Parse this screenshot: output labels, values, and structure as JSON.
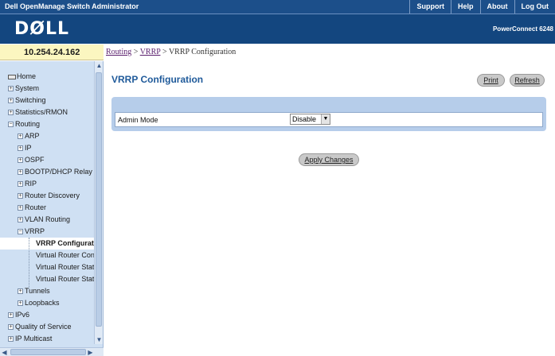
{
  "app": {
    "title": "Dell OpenManage Switch Administrator",
    "links": [
      "Support",
      "Help",
      "About",
      "Log Out"
    ],
    "logo": "DØLL",
    "product": "PowerConnect 6248"
  },
  "ip_address": "10.254.24.162",
  "breadcrumb": {
    "routing": "Routing",
    "sep1": ">",
    "vrrp": "VRRP",
    "sep2": ">",
    "current": "VRRP Configuration"
  },
  "sidebar": {
    "items": [
      {
        "label": "Home",
        "level": 0,
        "icon": "home-icon"
      },
      {
        "label": "System",
        "level": 0,
        "expander": "+"
      },
      {
        "label": "Switching",
        "level": 0,
        "expander": "+"
      },
      {
        "label": "Statistics/RMON",
        "level": 0,
        "expander": "+"
      },
      {
        "label": "Routing",
        "level": 0,
        "expander": "−"
      },
      {
        "label": "ARP",
        "level": 1,
        "expander": "+"
      },
      {
        "label": "IP",
        "level": 1,
        "expander": "+"
      },
      {
        "label": "OSPF",
        "level": 1,
        "expander": "+"
      },
      {
        "label": "BOOTP/DHCP Relay",
        "level": 1,
        "expander": "+"
      },
      {
        "label": "RIP",
        "level": 1,
        "expander": "+"
      },
      {
        "label": "Router Discovery",
        "level": 1,
        "expander": "+"
      },
      {
        "label": "Router",
        "level": 1,
        "expander": "+"
      },
      {
        "label": "VLAN Routing",
        "level": 1,
        "expander": "+"
      },
      {
        "label": "VRRP",
        "level": 1,
        "expander": "−"
      },
      {
        "label": "VRRP Configuration",
        "level": 2,
        "selected": true
      },
      {
        "label": "Virtual Router Configuration",
        "level": 2
      },
      {
        "label": "Virtual Router Status",
        "level": 2
      },
      {
        "label": "Virtual Router Statistics",
        "level": 2
      },
      {
        "label": "Tunnels",
        "level": 1,
        "expander": "+"
      },
      {
        "label": "Loopbacks",
        "level": 1,
        "expander": "+"
      },
      {
        "label": "IPv6",
        "level": 0,
        "expander": "+"
      },
      {
        "label": "Quality of Service",
        "level": 0,
        "expander": "+"
      },
      {
        "label": "IP Multicast",
        "level": 0,
        "expander": "+"
      }
    ]
  },
  "main": {
    "title": "VRRP Configuration",
    "print_label": "Print",
    "refresh_label": "Refresh",
    "admin_mode_label": "Admin Mode",
    "admin_mode_value": "Disable",
    "apply_label": "Apply Changes"
  },
  "colors": {
    "header_bg": "#1c4f8a",
    "sidebar_bg": "#cfe0f3",
    "title_color": "#1f5a9a",
    "panel_bg": "#b6cdea"
  }
}
